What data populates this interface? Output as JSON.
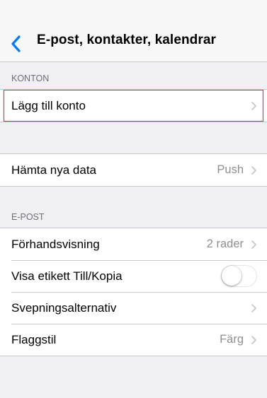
{
  "navbar": {
    "title": "E-post, kontakter, kalendrar",
    "back_icon": "chevron-left-icon"
  },
  "accounts_section": {
    "header": "KONTON",
    "add_account_label": "Lägg till konto"
  },
  "fetch_section": {
    "fetch_label": "Hämta nya data",
    "fetch_value": "Push"
  },
  "mail_section": {
    "header": "E-POST",
    "preview_label": "Förhandsvisning",
    "preview_value": "2 rader",
    "show_to_cc_label": "Visa etikett Till/Kopia",
    "show_to_cc_on": false,
    "swipe_label": "Svepningsalternativ",
    "flag_label": "Flaggstil",
    "flag_value": "Färg"
  },
  "colors": {
    "accent": "#007aff",
    "highlight": "#e0313b",
    "secondary_text": "#8e8e93"
  }
}
